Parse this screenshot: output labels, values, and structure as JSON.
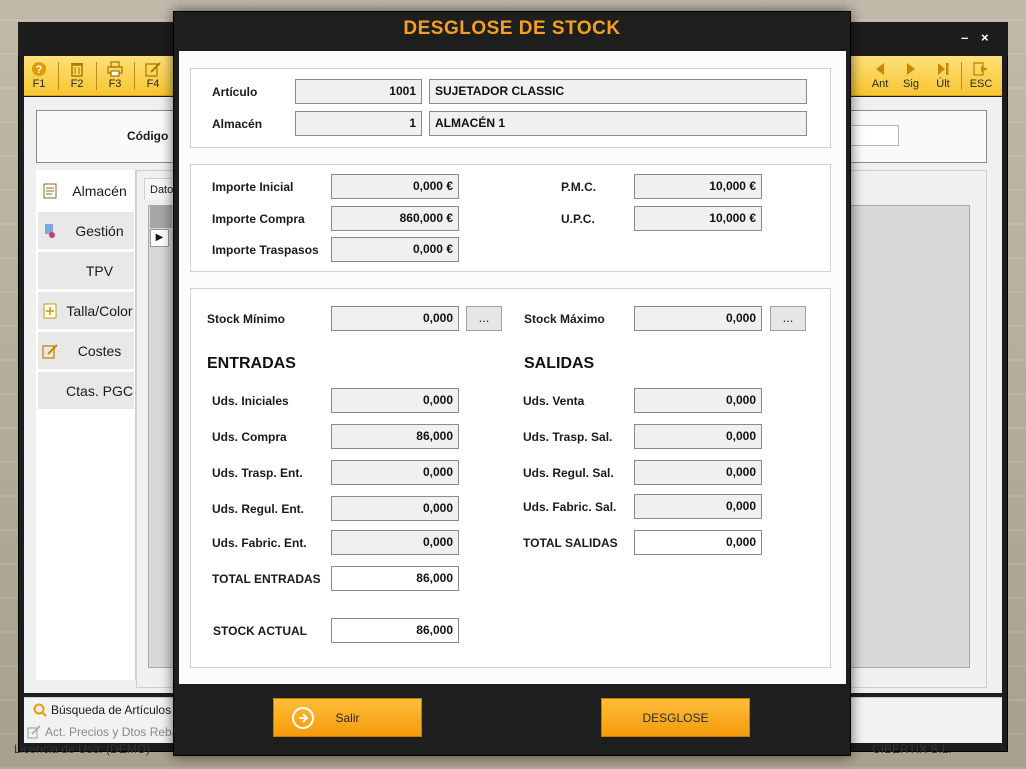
{
  "background_window": {
    "window_controls": {
      "minimize": "–",
      "close": "×"
    },
    "toolbar": {
      "left_buttons": [
        {
          "label": "F1",
          "icon": "help-icon"
        },
        {
          "label": "F2",
          "icon": "trash-icon"
        },
        {
          "label": "F3",
          "icon": "print-icon"
        },
        {
          "label": "F4",
          "icon": "edit-icon"
        }
      ],
      "right_buttons": [
        {
          "label": "Ant",
          "icon": "prev-icon"
        },
        {
          "label": "Sig",
          "icon": "next-icon"
        },
        {
          "label": "Últ",
          "icon": "last-icon"
        },
        {
          "label": "ESC",
          "icon": "exit-icon"
        }
      ]
    },
    "code_label": "Código",
    "sidebar": [
      {
        "label": "Almacén",
        "icon": "document-icon",
        "active": true
      },
      {
        "label": "Gestión",
        "icon": "gestion-icon"
      },
      {
        "label": "TPV",
        "icon": ""
      },
      {
        "label": "Talla/Color",
        "icon": "add-document-icon"
      },
      {
        "label": "Costes",
        "icon": "edit-icon"
      },
      {
        "label": "Ctas. PGC",
        "icon": ""
      }
    ],
    "tab_label": "Dato",
    "status": {
      "busqueda": "Búsqueda de Artículos",
      "precios": "Act. Precios y Dtos Reba",
      "licencia": "Licencia de Uso: (DEMO)",
      "company": "CIBERTIX S.L."
    }
  },
  "dialog": {
    "title": "DESGLOSE DE STOCK",
    "articulo": {
      "label": "Artículo",
      "code": "1001",
      "name": "SUJETADOR CLASSIC"
    },
    "almacen": {
      "label": "Almacén",
      "code": "1",
      "name": "ALMACÉN 1"
    },
    "importes": {
      "inicial": {
        "label": "Importe Inicial",
        "value": "0,000 €"
      },
      "compra": {
        "label": "Importe Compra",
        "value": "860,000 €"
      },
      "traspasos": {
        "label": "Importe Traspasos",
        "value": "0,000 €"
      },
      "pmc": {
        "label": "P.M.C.",
        "value": "10,000 €"
      },
      "upc": {
        "label": "U.P.C.",
        "value": "10,000 €"
      }
    },
    "stock_minimo": {
      "label": "Stock Mínimo",
      "value": "0,000",
      "button": "..."
    },
    "stock_maximo": {
      "label": "Stock Máximo",
      "value": "0,000",
      "button": "..."
    },
    "entradas": {
      "heading": "ENTRADAS",
      "rows": [
        {
          "label": "Uds. Iniciales",
          "value": "0,000"
        },
        {
          "label": "Uds. Compra",
          "value": "86,000"
        },
        {
          "label": "Uds. Trasp. Ent.",
          "value": "0,000"
        },
        {
          "label": "Uds. Regul. Ent.",
          "value": "0,000"
        },
        {
          "label": "Uds. Fabric. Ent.",
          "value": "0,000"
        }
      ],
      "total": {
        "label": "TOTAL ENTRADAS",
        "value": "86,000"
      }
    },
    "salidas": {
      "heading": "SALIDAS",
      "rows": [
        {
          "label": "Uds. Venta",
          "value": "0,000"
        },
        {
          "label": "Uds. Trasp. Sal.",
          "value": "0,000"
        },
        {
          "label": "Uds. Regul. Sal.",
          "value": "0,000"
        },
        {
          "label": "Uds. Fabric. Sal.",
          "value": "0,000"
        }
      ],
      "total": {
        "label": "TOTAL SALIDAS",
        "value": "0,000"
      }
    },
    "stock_actual": {
      "label": "STOCK ACTUAL",
      "value": "86,000"
    },
    "buttons": {
      "salir": "Salir",
      "desglose": "DESGLOSE"
    },
    "colors": {
      "accent": "#f5a020",
      "button": "#f59b0c",
      "frame": "#1e1e1e"
    }
  }
}
